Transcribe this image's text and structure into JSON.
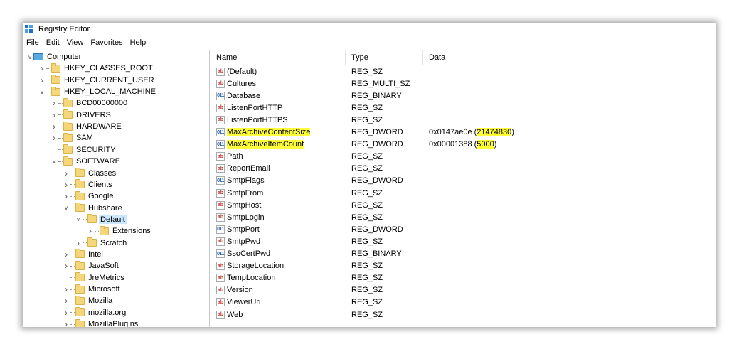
{
  "window": {
    "title": "Registry Editor"
  },
  "menu": [
    "File",
    "Edit",
    "View",
    "Favorites",
    "Help"
  ],
  "tree": [
    {
      "label": "Computer",
      "level": 0,
      "expanded": true,
      "icon": "computer"
    },
    {
      "label": "HKEY_CLASSES_ROOT",
      "level": 1,
      "expanded": false
    },
    {
      "label": "HKEY_CURRENT_USER",
      "level": 1,
      "expanded": false
    },
    {
      "label": "HKEY_LOCAL_MACHINE",
      "level": 1,
      "expanded": true
    },
    {
      "label": "BCD00000000",
      "level": 2,
      "expanded": false
    },
    {
      "label": "DRIVERS",
      "level": 2,
      "expanded": false
    },
    {
      "label": "HARDWARE",
      "level": 2,
      "expanded": false
    },
    {
      "label": "SAM",
      "level": 2,
      "expanded": false
    },
    {
      "label": "SECURITY",
      "level": 2,
      "leaf": true
    },
    {
      "label": "SOFTWARE",
      "level": 2,
      "expanded": true
    },
    {
      "label": "Classes",
      "level": 3,
      "expanded": false
    },
    {
      "label": "Clients",
      "level": 3,
      "expanded": false
    },
    {
      "label": "Google",
      "level": 3,
      "expanded": false
    },
    {
      "label": "Hubshare",
      "level": 3,
      "expanded": true
    },
    {
      "label": "Default",
      "level": 4,
      "expanded": true,
      "selected": true
    },
    {
      "label": "Extensions",
      "level": 5,
      "expanded": false
    },
    {
      "label": "Scratch",
      "level": 4,
      "expanded": false
    },
    {
      "label": "Intel",
      "level": 3,
      "expanded": false
    },
    {
      "label": "JavaSoft",
      "level": 3,
      "expanded": false
    },
    {
      "label": "JreMetrics",
      "level": 3,
      "leaf": true
    },
    {
      "label": "Microsoft",
      "level": 3,
      "expanded": false
    },
    {
      "label": "Mozilla",
      "level": 3,
      "expanded": false
    },
    {
      "label": "mozilla.org",
      "level": 3,
      "expanded": false
    },
    {
      "label": "MozillaPlugins",
      "level": 3,
      "expanded": false
    }
  ],
  "columns": {
    "name": "Name",
    "type": "Type",
    "data": "Data"
  },
  "values": [
    {
      "name": "(Default)",
      "type": "REG_SZ",
      "data": "",
      "icon": "ab"
    },
    {
      "name": "Cultures",
      "type": "REG_MULTI_SZ",
      "data": "",
      "icon": "ab"
    },
    {
      "name": "Database",
      "type": "REG_BINARY",
      "data": "",
      "icon": "bin"
    },
    {
      "name": "ListenPortHTTP",
      "type": "REG_SZ",
      "data": "",
      "icon": "ab"
    },
    {
      "name": "ListenPortHTTPS",
      "type": "REG_SZ",
      "data": "",
      "icon": "ab"
    },
    {
      "name": "MaxArchiveContentSize",
      "type": "REG_DWORD",
      "data_hex": "0x0147ae0e",
      "data_dec": "21474830",
      "icon": "bin",
      "highlight": true
    },
    {
      "name": "MaxArchiveItemCount",
      "type": "REG_DWORD",
      "data_hex": "0x00001388",
      "data_dec": "5000",
      "icon": "bin",
      "highlight": true
    },
    {
      "name": "Path",
      "type": "REG_SZ",
      "data": "",
      "icon": "ab"
    },
    {
      "name": "ReportEmail",
      "type": "REG_SZ",
      "data": "",
      "icon": "ab"
    },
    {
      "name": "SmtpFlags",
      "type": "REG_DWORD",
      "data": "",
      "icon": "bin"
    },
    {
      "name": "SmtpFrom",
      "type": "REG_SZ",
      "data": "",
      "icon": "ab"
    },
    {
      "name": "SmtpHost",
      "type": "REG_SZ",
      "data": "",
      "icon": "ab"
    },
    {
      "name": "SmtpLogin",
      "type": "REG_SZ",
      "data": "",
      "icon": "ab"
    },
    {
      "name": "SmtpPort",
      "type": "REG_DWORD",
      "data": "",
      "icon": "bin"
    },
    {
      "name": "SmtpPwd",
      "type": "REG_SZ",
      "data": "",
      "icon": "ab"
    },
    {
      "name": "SsoCertPwd",
      "type": "REG_BINARY",
      "data": "",
      "icon": "bin"
    },
    {
      "name": "StorageLocation",
      "type": "REG_SZ",
      "data": "",
      "icon": "ab"
    },
    {
      "name": "TempLocation",
      "type": "REG_SZ",
      "data": "",
      "icon": "ab"
    },
    {
      "name": "Version",
      "type": "REG_SZ",
      "data": "",
      "icon": "ab"
    },
    {
      "name": "ViewerUri",
      "type": "REG_SZ",
      "data": "",
      "icon": "ab"
    },
    {
      "name": "Web",
      "type": "REG_SZ",
      "data": "",
      "icon": "ab"
    }
  ],
  "colors": {
    "highlight": "#ffff3a",
    "selection": "#cce8ff",
    "folder": "#f5d77a"
  }
}
